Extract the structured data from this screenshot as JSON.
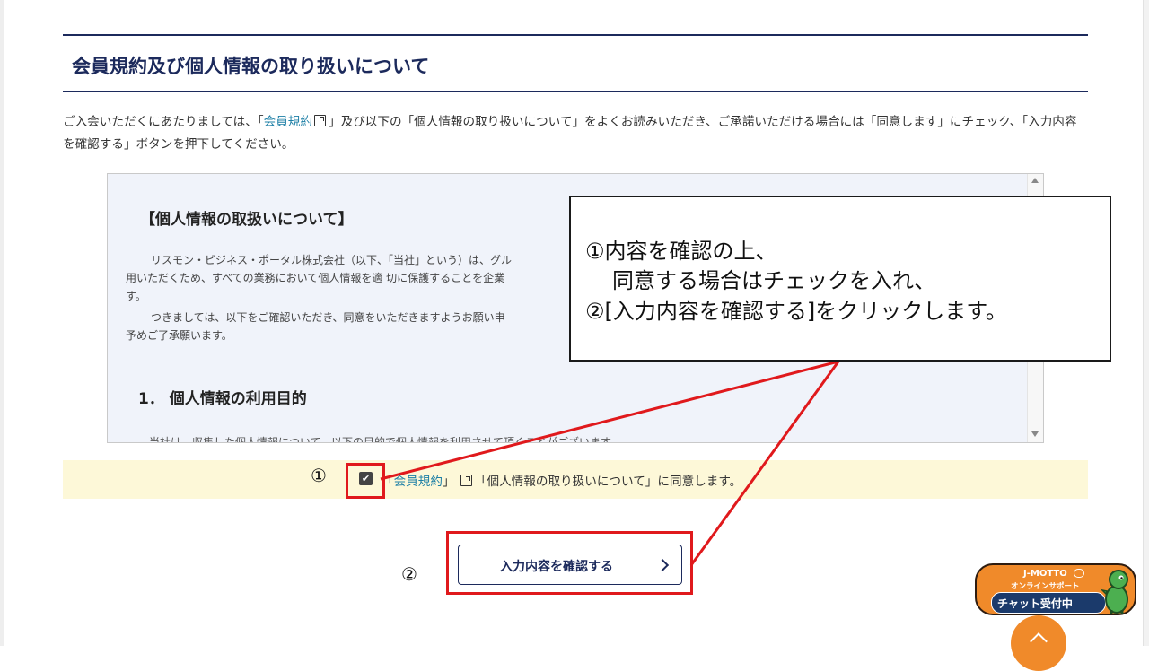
{
  "page": {
    "title": "会員規約及び個人情報の取り扱いについて",
    "intro_before": "ご入会いただくにあたりましては、「",
    "intro_link": "会員規約",
    "intro_after": "」及び以下の「個人情報の取り扱いについて」をよくお読みいただき、ご承諾いただける場合には「同意します」にチェック、「入力内容を確認する」ボタンを押下してください。"
  },
  "policy_box": {
    "heading": "【個人情報の取扱いについて】",
    "para1": "リスモン・ビジネス・ポータル株式会社（以下、「当社」という）は、グル",
    "para1b": "用いただくため、すべての業務において個人情報を適 切に保護することを企業",
    "para1c": "す。",
    "para2": "つきましては、以下をご確認いただき、同意をいただきますようお願い申",
    "para2b": "予めご了承願います。",
    "section1": "1．  個人情報の利用目的",
    "cut_text": "当社は、収集した個人情報について、以下の目的で個人情報を利用させて頂くことがございます。"
  },
  "agreement": {
    "step_marker": "①",
    "checked": true,
    "text_prefix": "「",
    "link_label": "会員規約",
    "text_mid": "」",
    "text_after": "「個人情報の取り扱いについて」に同意します。"
  },
  "confirm": {
    "step_marker": "②",
    "button_label": "入力内容を確認する"
  },
  "callout": {
    "line1": "①内容を確認の上、",
    "line2": "同意する場合はチェックを入れ、",
    "line3": "②[入力内容を確認する]をクリックします。"
  },
  "chat_widget": {
    "brand": "J-MOTTO",
    "subtitle": "オンラインサポート",
    "status": "チャット受付中"
  },
  "colors": {
    "navy": "#1c2a5c",
    "link": "#1d7fa6",
    "highlight_red": "#e0191c",
    "agree_bg": "#fdf8d8",
    "orange": "#f08a2a"
  },
  "icons": {
    "external_link": "external-link-icon",
    "checkbox": "checkbox-checked-icon",
    "button_chevron": "chevron-right-icon",
    "scroll_top": "chevron-up-icon",
    "mascot": "dinosaur-mascot-icon"
  }
}
